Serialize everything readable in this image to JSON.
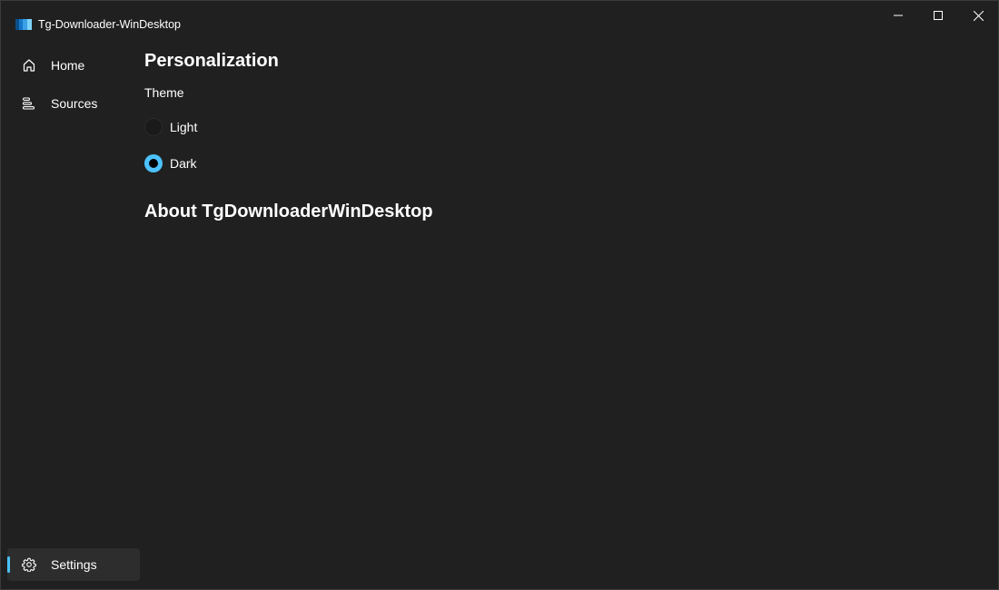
{
  "window": {
    "title": "Tg-Downloader-WinDesktop",
    "accent_color": "#4cc2ff",
    "background_color": "#202020"
  },
  "icons": {
    "app": "app-logo-icon",
    "minimize": "minimize-icon",
    "maximize": "maximize-icon",
    "close": "close-icon",
    "home": "home-icon",
    "sources": "list-icon",
    "settings": "gear-icon"
  },
  "navigation": {
    "items": [
      {
        "label": "Home",
        "icon": "home-icon",
        "selected": false
      },
      {
        "label": "Sources",
        "icon": "list-icon",
        "selected": false
      }
    ],
    "footer": {
      "label": "Settings",
      "icon": "gear-icon",
      "selected": true
    }
  },
  "settings": {
    "personalization_title": "Personalization",
    "theme_label": "Theme",
    "theme_options": [
      {
        "label": "Light",
        "checked": false
      },
      {
        "label": "Dark",
        "checked": true
      }
    ],
    "about_title": "About TgDownloaderWinDesktop"
  }
}
